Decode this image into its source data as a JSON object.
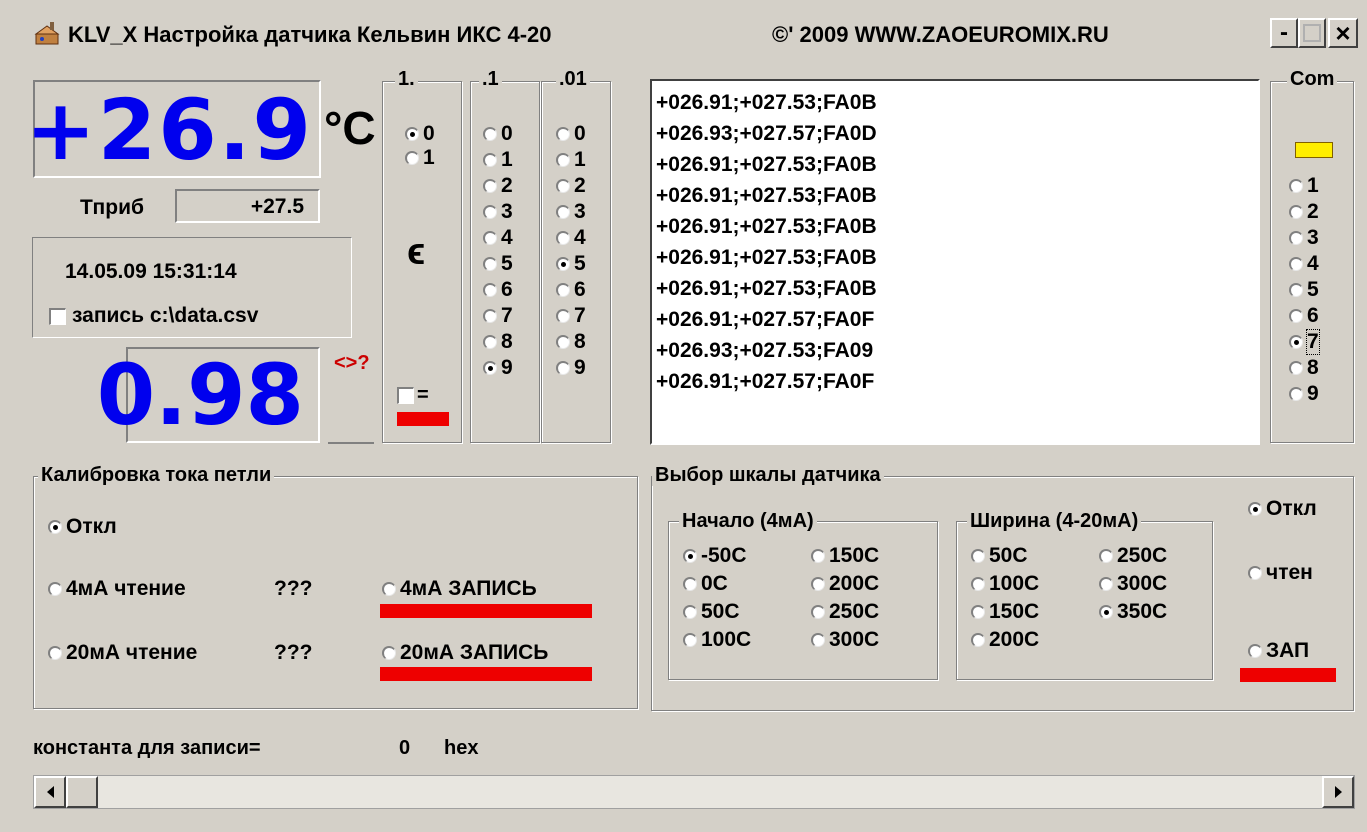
{
  "titlebar": {
    "title": "KLV_X Настройка датчика Кельвин ИКС 4-20",
    "copyright": "©' 2009  WWW.ZAOEUROMIX.RU",
    "min": "-",
    "close": "×"
  },
  "temperature": {
    "value": "+26.9",
    "unit": "°C"
  },
  "tpriv": {
    "label": "Тприб",
    "value": "+27.5"
  },
  "datetime": "14.05.09 15:31:14",
  "record": {
    "label": "запись c:\\data.csv"
  },
  "emissivity": {
    "value": "0.98",
    "query": "<>?",
    "symbol": "ϵ",
    "eq_label": "="
  },
  "digit_groups": {
    "ones": {
      "title": "1.",
      "options": [
        "0",
        "1"
      ],
      "selected": "0"
    },
    "tenths": {
      "title": ".1",
      "options": [
        "0",
        "1",
        "2",
        "3",
        "4",
        "5",
        "6",
        "7",
        "8",
        "9"
      ],
      "selected": "9"
    },
    "hundredths": {
      "title": ".01",
      "options": [
        "0",
        "1",
        "2",
        "3",
        "4",
        "5",
        "6",
        "7",
        "8",
        "9"
      ],
      "selected": "5"
    }
  },
  "log_lines": [
    "+026.91;+027.53;FA0B",
    "+026.93;+027.57;FA0D",
    "+026.91;+027.53;FA0B",
    "+026.91;+027.53;FA0B",
    "+026.91;+027.53;FA0B",
    "+026.91;+027.53;FA0B",
    "+026.91;+027.53;FA0B",
    "+026.91;+027.57;FA0F",
    "+026.93;+027.53;FA09",
    "+026.91;+027.57;FA0F"
  ],
  "com": {
    "title": "Com",
    "options": [
      "1",
      "2",
      "3",
      "4",
      "5",
      "6",
      "7",
      "8",
      "9"
    ],
    "selected": "7",
    "indicator_color": "#ffee00"
  },
  "calibration": {
    "title": "Калибровка тока петли",
    "off": "Откл",
    "read4": "4мА чтение",
    "read4_value": "???",
    "write4": "4мА ЗАПИСЬ",
    "read20": "20мА чтение",
    "read20_value": "???",
    "write20": "20мА ЗАПИСЬ"
  },
  "scale": {
    "title": "Выбор шкалы датчика",
    "start_title": "Начало (4мА)",
    "start_options": [
      "-50C",
      "150C",
      "0C",
      "200C",
      "50C",
      "250C",
      "100C",
      "300C"
    ],
    "start_selected": "-50C",
    "width_title": "Ширина (4-20мА)",
    "width_options": [
      "50C",
      "250C",
      "100C",
      "300C",
      "150C",
      "350C",
      "200C"
    ],
    "width_selected": "350C",
    "mode_off": "Откл",
    "mode_read": "чтен",
    "mode_write": "ЗАП"
  },
  "constant": {
    "label": "константа для записи=",
    "value": "0",
    "unit": "hex"
  },
  "colors": {
    "accent_blue": "#0000ee",
    "red_bar": "#ee0000",
    "query_red": "#cc0000"
  }
}
